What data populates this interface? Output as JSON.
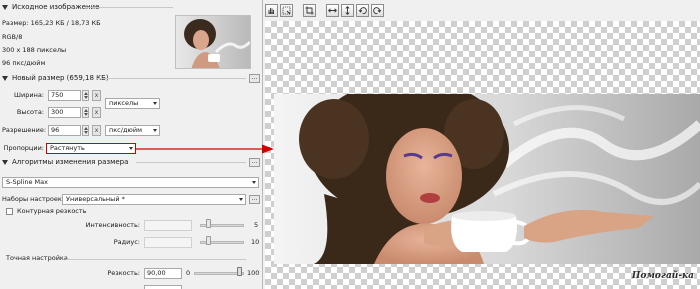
{
  "source": {
    "header": "Исходное изображение",
    "size_line": "Размер: 165,23 КБ / 18,73 КБ",
    "color_mode": "RGB/8",
    "dimensions": "300 x 188 пикселы",
    "resolution": "96 пкс/дюйм"
  },
  "new_size": {
    "header": "Новый размер (659,18 КБ)",
    "width_label": "Ширина:",
    "width_value": "750",
    "height_label": "Высота:",
    "height_value": "300",
    "unit_value": "пикселы",
    "resolution_label": "Разрешение:",
    "resolution_value": "96",
    "resolution_unit": "пкс/дюйм",
    "proportions_label": "Пропорции:",
    "proportions_value": "Растянуть"
  },
  "algorithms": {
    "header": "Алгоритмы изменения размера",
    "method_value": "S-Spline Max",
    "presets_label": "Наборы настроек:",
    "presets_value": "Универсальный *",
    "sharpness_label": "Контурная резкость",
    "intensity_label": "Интенсивность:",
    "intensity_max": "5",
    "radius_label": "Радиус:",
    "radius_max": "10",
    "fine_tune_label": "Точная настройка",
    "sharp_label": "Резкость:",
    "sharp_value": "90,00",
    "sharp_min": "0",
    "sharp_max": "100",
    "sharp_level": 0.9
  },
  "watermark": "Помогай-ка",
  "colors": {
    "arrow": "#d10000",
    "highlight": "#cc0000"
  }
}
